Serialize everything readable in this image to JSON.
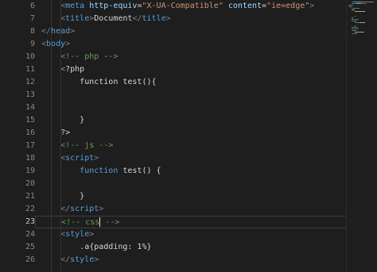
{
  "editor": {
    "lines": [
      {
        "num": "6",
        "tokens": [
          [
            "punc",
            "<"
          ],
          [
            "tag",
            "meta"
          ],
          [
            "text",
            " "
          ],
          [
            "attr",
            "http-equiv"
          ],
          [
            "text",
            "="
          ],
          [
            "str",
            "\"X-UA-Compatible\""
          ],
          [
            "text",
            " "
          ],
          [
            "attr",
            "content"
          ],
          [
            "text",
            "="
          ],
          [
            "str",
            "\"ie=edge\""
          ],
          [
            "punc",
            ">"
          ]
        ],
        "indent": 2
      },
      {
        "num": "7",
        "tokens": [
          [
            "punc",
            "<"
          ],
          [
            "tag",
            "title"
          ],
          [
            "punc",
            ">"
          ],
          [
            "text",
            "Document"
          ],
          [
            "punc",
            "</"
          ],
          [
            "tag",
            "title"
          ],
          [
            "punc",
            ">"
          ]
        ],
        "indent": 2
      },
      {
        "num": "8",
        "tokens": [
          [
            "punc",
            "</"
          ],
          [
            "tag",
            "head"
          ],
          [
            "punc",
            ">"
          ]
        ],
        "indent": 0
      },
      {
        "num": "9",
        "tokens": [
          [
            "punc",
            "<"
          ],
          [
            "tag",
            "body"
          ],
          [
            "punc",
            ">"
          ]
        ],
        "indent": 0
      },
      {
        "num": "10",
        "tokens": [
          [
            "comment",
            "<!-- php -->"
          ]
        ],
        "indent": 2
      },
      {
        "num": "11",
        "tokens": [
          [
            "php",
            "<"
          ],
          [
            "text",
            "?php"
          ]
        ],
        "indent": 2
      },
      {
        "num": "12",
        "tokens": [
          [
            "text",
            "function test(){"
          ]
        ],
        "indent": 4
      },
      {
        "num": "13",
        "tokens": [],
        "indent": 0
      },
      {
        "num": "14",
        "tokens": [],
        "indent": 0
      },
      {
        "num": "15",
        "tokens": [
          [
            "text",
            "}"
          ]
        ],
        "indent": 4
      },
      {
        "num": "16",
        "tokens": [
          [
            "text",
            "?>"
          ]
        ],
        "indent": 2
      },
      {
        "num": "17",
        "tokens": [
          [
            "comment",
            "<!-- js -->"
          ]
        ],
        "indent": 2
      },
      {
        "num": "18",
        "tokens": [
          [
            "punc",
            "<"
          ],
          [
            "tag",
            "script"
          ],
          [
            "punc",
            ">"
          ]
        ],
        "indent": 2
      },
      {
        "num": "19",
        "tokens": [
          [
            "tag",
            "function"
          ],
          [
            "text",
            " test() {"
          ]
        ],
        "indent": 4
      },
      {
        "num": "20",
        "tokens": [],
        "indent": 0
      },
      {
        "num": "21",
        "tokens": [
          [
            "text",
            "}"
          ]
        ],
        "indent": 4
      },
      {
        "num": "22",
        "tokens": [
          [
            "punc",
            "</"
          ],
          [
            "tag",
            "script"
          ],
          [
            "punc",
            ">"
          ]
        ],
        "indent": 2
      },
      {
        "num": "23",
        "tokens": [
          [
            "comment",
            "<!-- css"
          ],
          [
            "cursor",
            ""
          ],
          [
            "comment",
            " -->"
          ]
        ],
        "indent": 2,
        "active": true
      },
      {
        "num": "24",
        "tokens": [
          [
            "punc",
            "<"
          ],
          [
            "tag",
            "style"
          ],
          [
            "punc",
            ">"
          ]
        ],
        "indent": 2
      },
      {
        "num": "25",
        "tokens": [
          [
            "text",
            ".a{padding: 1%}"
          ]
        ],
        "indent": 4
      },
      {
        "num": "26",
        "tokens": [
          [
            "punc",
            "</"
          ],
          [
            "tag",
            "style"
          ],
          [
            "punc",
            ">"
          ]
        ],
        "indent": 2
      }
    ]
  },
  "colors": {
    "background": "#1e1e1e",
    "tag": "#569cd6",
    "attr": "#9cdcfe",
    "string": "#ce9178",
    "comment": "#6a9955",
    "text": "#d4d4d4",
    "line_number": "#858585"
  }
}
